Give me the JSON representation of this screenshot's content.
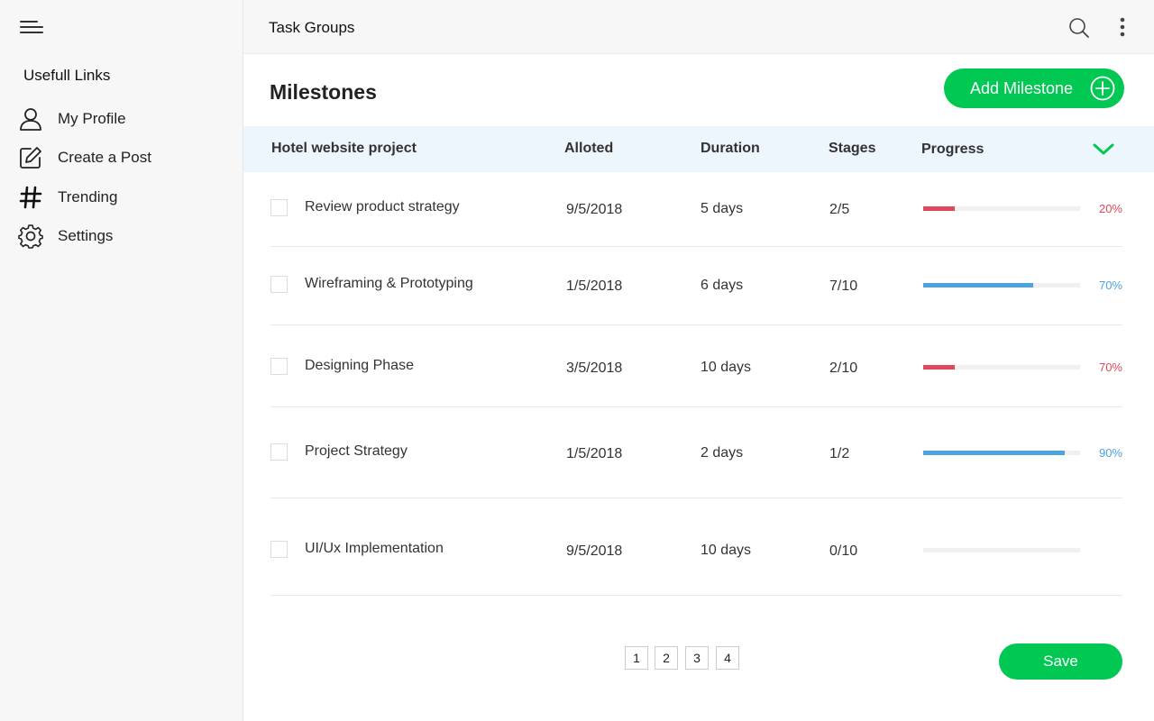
{
  "sidebar": {
    "heading": "Usefull Links",
    "items": [
      {
        "label": "My Profile",
        "icon": "user-icon"
      },
      {
        "label": "Create a Post",
        "icon": "edit-icon"
      },
      {
        "label": "Trending",
        "icon": "hash-icon"
      },
      {
        "label": "Settings",
        "icon": "gear-icon"
      }
    ]
  },
  "topbar": {
    "title": "Task Groups"
  },
  "main": {
    "title": "Milestones",
    "add_button_label": "Add Milestone",
    "save_label": "Save",
    "table": {
      "headers": {
        "project": "Hotel website project",
        "alloted": "Alloted",
        "duration": "Duration",
        "stages": "Stages",
        "progress": "Progress"
      },
      "rows": [
        {
          "task": "Review product strategy",
          "alloted": "9/5/2018",
          "duration": "5 days",
          "stages": "2/5",
          "progress": 0.2,
          "progress_label": "20%",
          "color": "#e0475a"
        },
        {
          "task": "Wireframing & Prototyping",
          "alloted": "1/5/2018",
          "duration": "6 days",
          "stages": "7/10",
          "progress": 0.7,
          "progress_label": "70%",
          "color": "#4ca3dd"
        },
        {
          "task": "Designing Phase",
          "alloted": "3/5/2018",
          "duration": "10 days",
          "stages": "2/10",
          "progress": 0.2,
          "progress_label": "70%",
          "color": "#e0475a"
        },
        {
          "task": "Project Strategy",
          "alloted": "1/5/2018",
          "duration": "2 days",
          "stages": "1/2",
          "progress": 0.9,
          "progress_label": "90%",
          "color": "#4ca3dd"
        },
        {
          "task": "UI/Ux Implementation",
          "alloted": "9/5/2018",
          "duration": "10 days",
          "stages": "0/10",
          "progress": 0,
          "progress_label": "",
          "color": "#4ca3dd"
        }
      ]
    },
    "pagination": [
      "1",
      "2",
      "3",
      "4"
    ]
  },
  "colors": {
    "accent": "#00c853",
    "red": "#e0475a",
    "blue": "#4ca3dd",
    "header_bg": "#eef6fd"
  }
}
